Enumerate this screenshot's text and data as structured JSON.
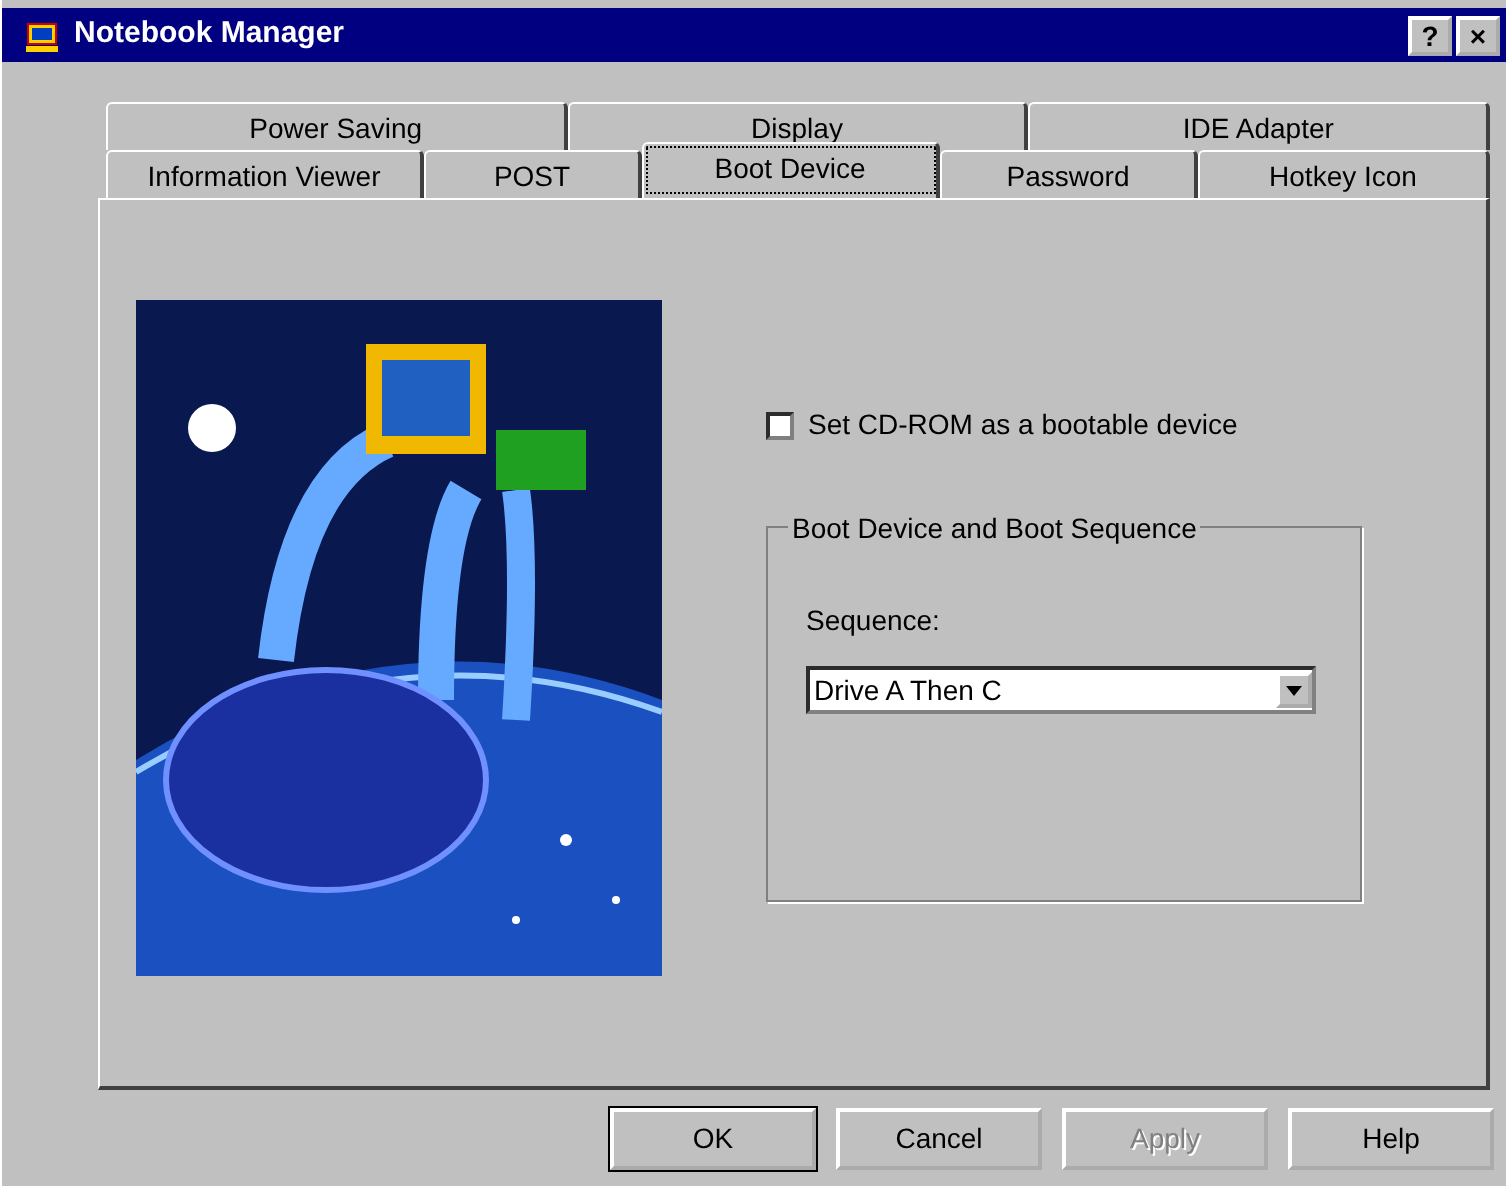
{
  "window": {
    "title": "Notebook Manager",
    "title_buttons": [
      "?",
      "×"
    ]
  },
  "tab_rows": [
    [
      {
        "label": "Power Saving",
        "selected": false
      },
      {
        "label": "Display",
        "selected": false
      },
      {
        "label": "IDE Adapter",
        "selected": false
      }
    ],
    [
      {
        "label": "Information Viewer",
        "selected": false
      },
      {
        "label": "POST",
        "selected": false
      },
      {
        "label": "Boot Device",
        "selected": true
      },
      {
        "label": "Password",
        "selected": false
      },
      {
        "label": "Hotkey Icon",
        "selected": false
      }
    ]
  ],
  "cdrom_boot": {
    "label": "Set CD-ROM as a bootable device",
    "checked": false
  },
  "group": {
    "title": "Boot Device and Boot Sequence",
    "field_label": "Sequence:",
    "value": "Drive A Then C"
  },
  "buttons": [
    {
      "label": "OK",
      "disabled": false,
      "default": true
    },
    {
      "label": "Cancel",
      "disabled": false,
      "default": false
    },
    {
      "label": "Apply",
      "disabled": true,
      "default": false
    },
    {
      "label": "Help",
      "disabled": false,
      "default": false
    }
  ]
}
